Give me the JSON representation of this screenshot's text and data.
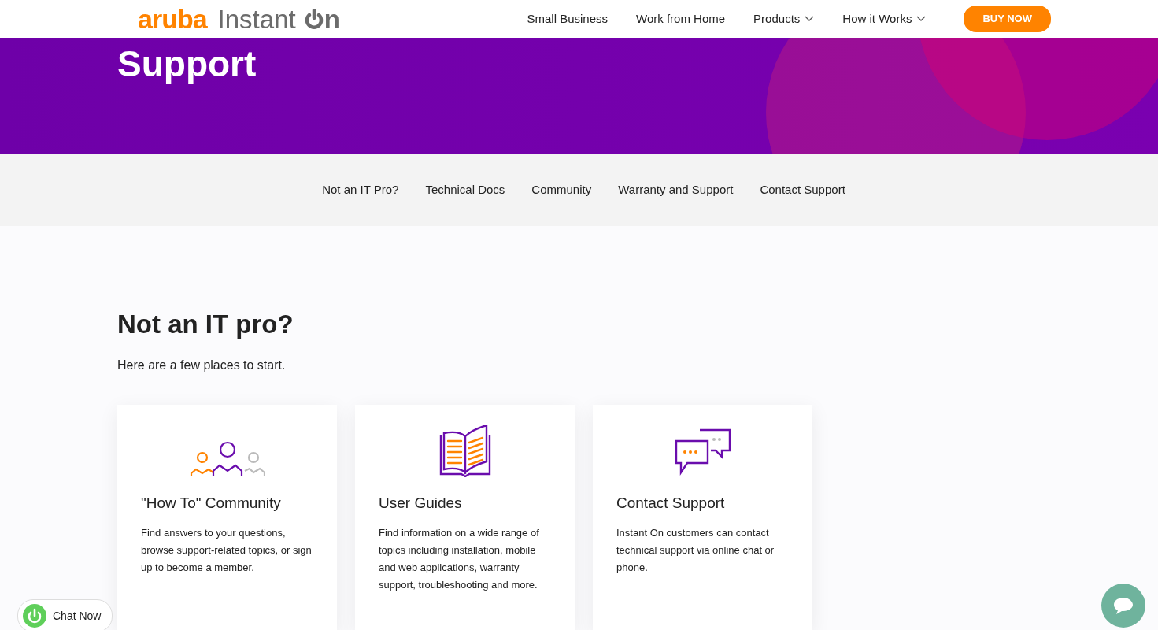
{
  "header": {
    "logo": {
      "brand": "aruba",
      "product": "Instant",
      "mark_letter": "n"
    },
    "nav": [
      {
        "label": "Small Business",
        "dropdown": false
      },
      {
        "label": "Work from Home",
        "dropdown": false
      },
      {
        "label": "Products",
        "dropdown": true
      },
      {
        "label": "How it Works",
        "dropdown": true
      }
    ],
    "cta": "BUY NOW"
  },
  "hero": {
    "title": "Support"
  },
  "subnav": [
    "Not an IT Pro?",
    "Technical Docs",
    "Community",
    "Warranty and Support",
    "Contact Support"
  ],
  "section": {
    "heading": "Not an IT pro?",
    "intro": "Here are a few places to start.",
    "cards": [
      {
        "kind": "people",
        "title": "\"How To\" Community",
        "text": "Find answers to your questions, browse support-related topics, or sign up to become a member."
      },
      {
        "kind": "book",
        "title": "User Guides",
        "text": "Find information on a wide range of topics including installation, mobile and web applications, warranty support, troubleshooting and more."
      },
      {
        "kind": "chat",
        "title": "Contact Support",
        "text": "Instant On customers can contact technical support via online chat or phone."
      }
    ]
  },
  "chat_button": {
    "label": "Chat Now"
  }
}
